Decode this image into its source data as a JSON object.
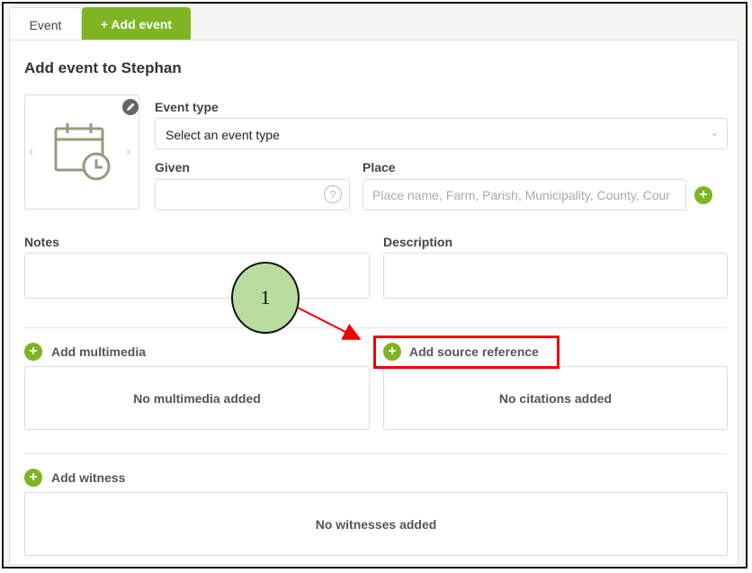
{
  "tabs": {
    "event": "Event",
    "add_event": "+ Add event"
  },
  "form": {
    "title": "Add event to Stephan",
    "event_type": {
      "label": "Event type",
      "value": "Select an event type"
    },
    "given": {
      "label": "Given",
      "help": "?"
    },
    "place": {
      "label": "Place",
      "placeholder": "Place name, Farm, Parish, Municipality, County, Cour"
    },
    "notes_label": "Notes",
    "description_label": "Description"
  },
  "sections": {
    "multimedia": {
      "link": "Add multimedia",
      "empty": "No multimedia added"
    },
    "source": {
      "link": "Add source reference",
      "empty": "No citations added"
    },
    "witness": {
      "link": "Add witness",
      "empty": "No witnesses added"
    }
  },
  "annotation": {
    "step": "1"
  },
  "icons": {
    "image_placeholder": "calendar-clock-icon",
    "edit": "pencil-icon",
    "add": "plus-circle-icon"
  },
  "colors": {
    "accent": "#7fb423",
    "highlight": "#e00000",
    "callout": "#b9dda0"
  }
}
